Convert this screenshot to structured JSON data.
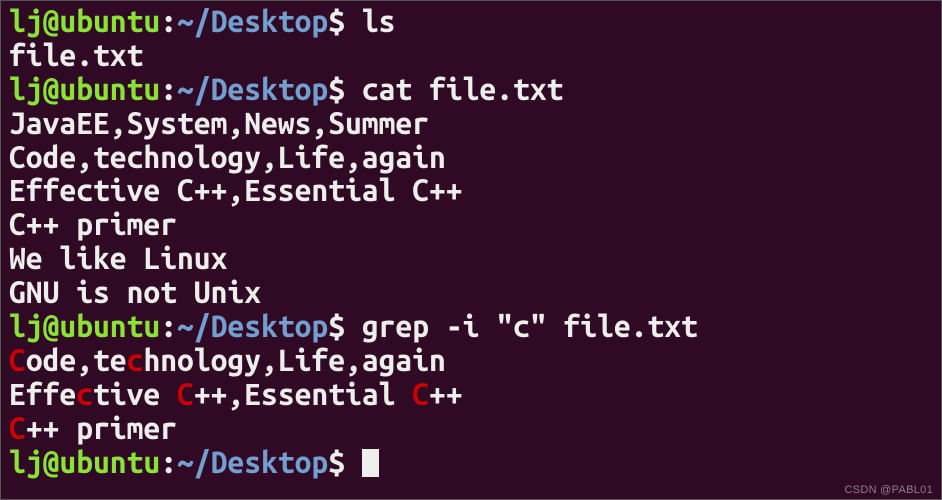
{
  "prompt": {
    "user": "lj@ubuntu",
    "sep1": ":",
    "path": "~/Desktop",
    "sep2": "$ "
  },
  "commands": {
    "ls": "ls",
    "cat": "cat file.txt",
    "grep": "grep -i \"c\" file.txt",
    "empty": ""
  },
  "ls_output": "file.txt",
  "cat_output": [
    "JavaEE,System,News,Summer",
    "Code,technology,Life,again",
    "Effective C++,Essential C++",
    "C++ primer",
    "We like Linux",
    "GNU is not Unix"
  ],
  "grep_output": [
    [
      {
        "t": "C",
        "hl": true
      },
      {
        "t": "ode,te",
        "hl": false
      },
      {
        "t": "c",
        "hl": true
      },
      {
        "t": "hnology,Life,again",
        "hl": false
      }
    ],
    [
      {
        "t": "Effe",
        "hl": false
      },
      {
        "t": "c",
        "hl": true
      },
      {
        "t": "tive ",
        "hl": false
      },
      {
        "t": "C",
        "hl": true
      },
      {
        "t": "++,Essential ",
        "hl": false
      },
      {
        "t": "C",
        "hl": true
      },
      {
        "t": "++",
        "hl": false
      }
    ],
    [
      {
        "t": "C",
        "hl": true
      },
      {
        "t": "++ primer",
        "hl": false
      }
    ]
  ],
  "watermark": "CSDN @PABL01"
}
